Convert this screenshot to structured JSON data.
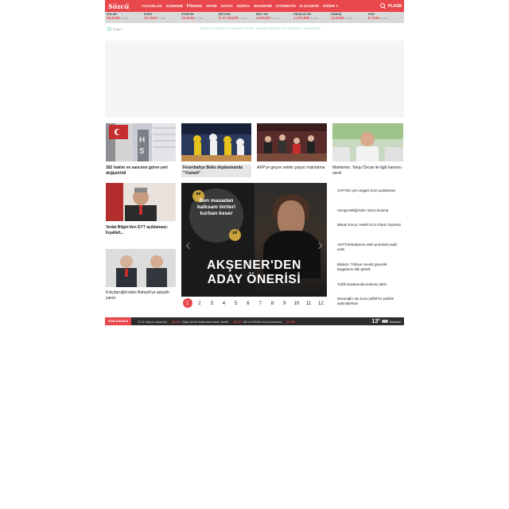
{
  "header": {
    "logo": "Sözcü",
    "nav": [
      "YAZARLAR",
      "GÜNDEM",
      "Fitness",
      "SPOR",
      "HAYAT",
      "DÜNYA",
      "EKONOMİ",
      "OTOMOTİV",
      "E-GAZETE",
      "DİĞER ▾"
    ],
    "login": "PLASB"
  },
  "ticker": [
    {
      "label": "DOLAR",
      "value": "18,6035",
      "change": "% 0,00"
    },
    {
      "label": "EURO",
      "value": "19,7623",
      "change": "% 0,00"
    },
    {
      "label": "STERLİN",
      "value": "22,5015",
      "change": "% 0,00"
    },
    {
      "label": "BITCOIN",
      "value": "$ 17.204,96",
      "change": "% 0,00"
    },
    {
      "label": "BIST 100",
      "value": "4.805,80",
      "change": "% 0,00"
    },
    {
      "label": "GRAM ALTIN",
      "value": "1.075,980",
      "change": "% 0,00"
    },
    {
      "label": "GÜMÜŞ",
      "value": "13,8155",
      "change": "% 0,00"
    },
    {
      "label": "FAİZ",
      "value": "8,7645",
      "change": "% 0,00"
    }
  ],
  "newsbar": {
    "today": "Bugün",
    "marquee": "SÖZCÜ GAZETESİ HABER SİTESİ HEMEN ABONE OL GÜNCEL HABERLER"
  },
  "cards": {
    "c1": "282 hakim ve savcının görev yeri değiştirildi",
    "c2": "Fenerbahçe Beko deplasmanda \"Yüzledi\"",
    "c3": "AKP'ye geçen vekile çarpıcı hatırlatma",
    "c4": "Mahkeme, Tanju Özcan ile ilgili kararını verdi",
    "c5": "Vedat Bilgin'den EYT açıklaması: İnşallah...",
    "c6": "Kılıçdaroğlu'ndan Bahçeli'ye adaylık yanıtı"
  },
  "slider": {
    "quote": "Ben masadan kalksam birileri kurban keser",
    "headline_line1": "AKŞENER'DEN",
    "headline_line2": "ADAY ÖNERİSİ",
    "pages": [
      "1",
      "2",
      "3",
      "4",
      "5",
      "6",
      "7",
      "8",
      "9",
      "10",
      "11",
      "12"
    ],
    "active_page": "1"
  },
  "right_list": [
    "CHP'den yeni asgari ücret açıklaması",
    "Avrupa Birliği'nden İran'a kınama",
    "Bakan Ersoy: Hedef 51,5 milyon ziyaretçi",
    "AKP'li belediyenin vakıf protokolü tepki çekti",
    "Blinken: Türkiye önemli güvenlik kaygılarını dile getirdi",
    "Trafik kazalarında korkunç tablo",
    "Davutoğlu: Bu konu şeffaf bir şekilde aydınlatılmalı"
  ],
  "breaking": {
    "label": "SON DAKİKA",
    "items": [
      {
        "time": "",
        "text": "51,5 milyon ziyaretçi"
      },
      {
        "time": "23:43",
        "text": "Olaylı derbi hakkında karar verildi"
      },
      {
        "time": "23:13",
        "text": "AB ve İM'den İran'a kınama"
      },
      {
        "time": "22:45",
        "text": ""
      }
    ],
    "temp": "13°",
    "city": "İstanbul"
  }
}
